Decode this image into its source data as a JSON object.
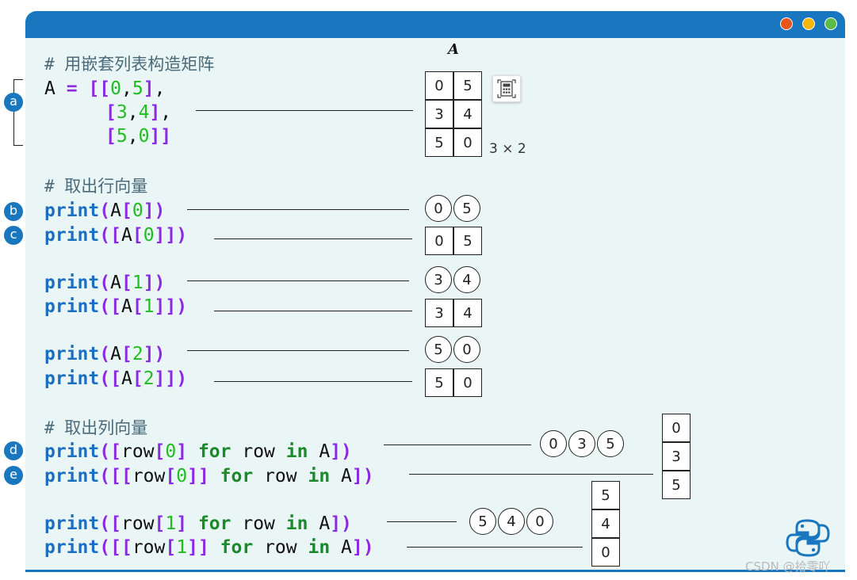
{
  "window": {
    "dots": [
      {
        "name": "close-dot",
        "color": "#e8541a"
      },
      {
        "name": "minimize-dot",
        "color": "#f5b50a"
      },
      {
        "name": "maximize-dot",
        "color": "#5dbb4a"
      }
    ]
  },
  "matrix": {
    "title": "A",
    "rows": [
      [
        "0",
        "5"
      ],
      [
        "3",
        "4"
      ],
      [
        "5",
        "0"
      ]
    ],
    "shape": "3 × 2"
  },
  "badges": [
    "a",
    "b",
    "c",
    "d",
    "e"
  ],
  "comments": {
    "construct": "# 用嵌套列表构造矩阵",
    "rows": "# 取出行向量",
    "cols": "# 取出列向量"
  },
  "code": {
    "line_a1": "A = [[0,5],",
    "line_a2": "[3,4],",
    "line_a3": "[5,0]]",
    "row0": "print(A[0])",
    "row0_2d": "print([A[0]])",
    "row1": "print(A[1])",
    "row1_2d": "print([A[1]])",
    "row2": "print(A[2])",
    "row2_2d": "print([A[2]])",
    "col0": "print([row[0] for row in A])",
    "col0_2d": "print([[row[0]] for row in A])",
    "col1": "print([row[1] for row in A])",
    "col1_2d": "print([[row[1]] for row in A])"
  },
  "results": {
    "row0_vec": [
      "0",
      "5"
    ],
    "row0_mat": [
      "0",
      "5"
    ],
    "row1_vec": [
      "3",
      "4"
    ],
    "row1_mat": [
      "3",
      "4"
    ],
    "row2_vec": [
      "5",
      "0"
    ],
    "row2_mat": [
      "5",
      "0"
    ],
    "col0_vec": [
      "0",
      "3",
      "5"
    ],
    "col0_mat": [
      "0",
      "3",
      "5"
    ],
    "col1_vec": [
      "5",
      "4",
      "0"
    ],
    "col1_mat": [
      "5",
      "4",
      "0"
    ]
  },
  "watermark": "CSDN @拾零吖"
}
